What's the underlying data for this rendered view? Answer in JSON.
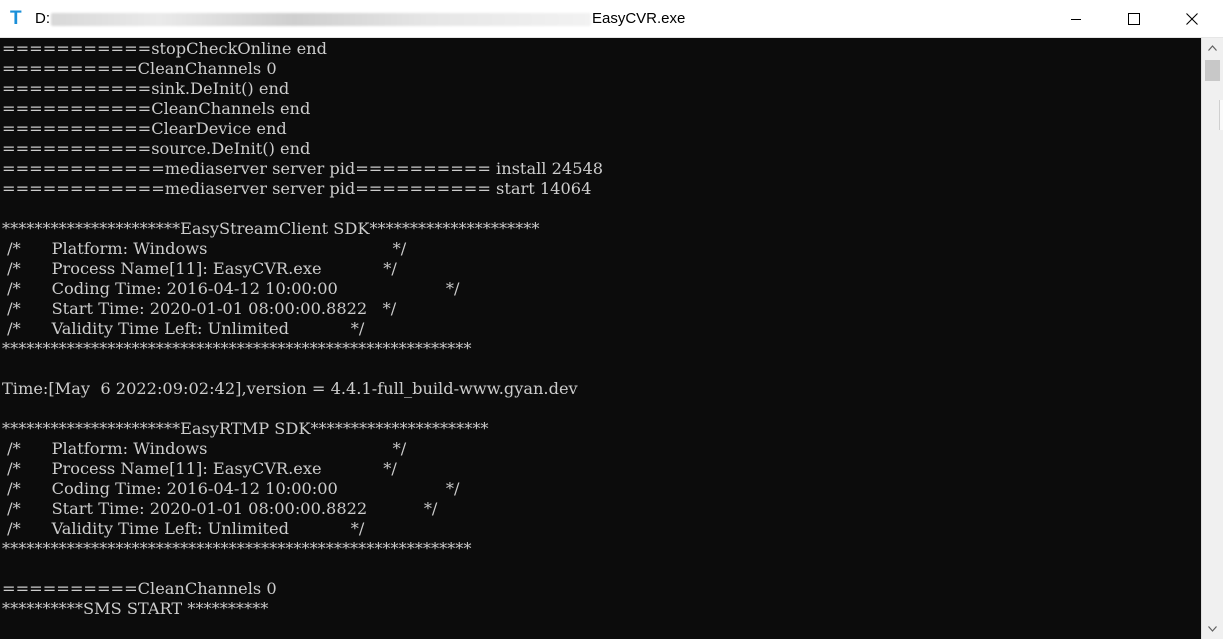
{
  "window": {
    "title_prefix": "D:",
    "title_suffix": "EasyCVR.exe",
    "icons": {
      "app": "terminal-t-icon",
      "minimize": "minimize-icon",
      "maximize": "maximize-icon",
      "close": "close-icon"
    }
  },
  "console": {
    "lines": [
      "===========stopCheckOnline end",
      "==========CleanChannels 0",
      "===========sink.DeInit() end",
      "===========CleanChannels end",
      "===========ClearDevice end",
      "===========source.DeInit() end",
      "============mediaserver server pid========== install 24548",
      "============mediaserver server pid========== start 14064",
      "",
      "**********************EasyStreamClient SDK*********************",
      " /*      Platform: Windows                                    */",
      " /*      Process Name[11]: EasyCVR.exe            */",
      " /*      Coding Time: 2016-04-12 10:00:00                     */",
      " /*      Start Time: 2020-01-01 08:00:00.8822   */",
      " /*      Validity Time Left: Unlimited            */",
      "**********************************************************",
      "",
      "Time:[May  6 2022:09:02:42],version = 4.4.1-full_build-www.gyan.dev",
      "",
      "**********************EasyRTMP SDK**********************",
      " /*      Platform: Windows                                    */",
      " /*      Process Name[11]: EasyCVR.exe            */",
      " /*      Coding Time: 2016-04-12 10:00:00                     */",
      " /*      Start Time: 2020-01-01 08:00:00.8822           */",
      " /*      Validity Time Left: Unlimited            */",
      "**********************************************************",
      "",
      "==========CleanChannels 0",
      "**********SMS START **********"
    ]
  },
  "colors": {
    "console_bg": "#0c0c0c",
    "console_fg": "#cccccc",
    "app_icon": "#1a8fd8"
  }
}
